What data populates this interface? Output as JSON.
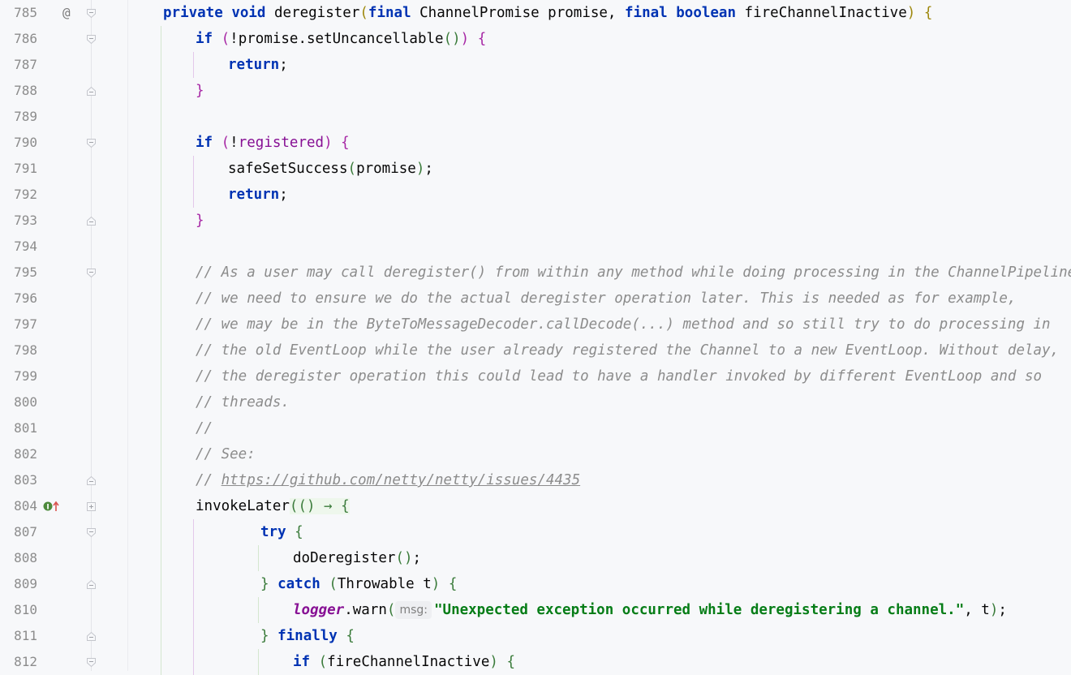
{
  "editor": {
    "lines": [
      {
        "num": "785",
        "gutter": "@",
        "fold": "open",
        "indent": 1,
        "tokens": [
          [
            "kw",
            "private"
          ],
          [
            "",
            " "
          ],
          [
            "kw",
            "void"
          ],
          [
            "",
            " deregister"
          ],
          [
            "bp",
            "("
          ],
          [
            "kw",
            "final"
          ],
          [
            "",
            " ChannelPromise promise, "
          ],
          [
            "kw",
            "final"
          ],
          [
            "",
            " "
          ],
          [
            "kw",
            "boolean"
          ],
          [
            "",
            " fireChannelInactive"
          ],
          [
            "bp",
            ")"
          ],
          [
            "",
            " "
          ],
          [
            "bp",
            "{"
          ]
        ]
      },
      {
        "num": "786",
        "fold": "open",
        "indent": 2,
        "tokens": [
          [
            "kw",
            "if"
          ],
          [
            "",
            " "
          ],
          [
            "bp2",
            "("
          ],
          [
            "",
            "!promise.setUncancellable"
          ],
          [
            "bp3",
            "()"
          ],
          [
            "bp2",
            ")"
          ],
          [
            "",
            " "
          ],
          [
            "bp2",
            "{"
          ]
        ]
      },
      {
        "num": "787",
        "indent": 3,
        "tokens": [
          [
            "kw",
            "return"
          ],
          [
            "",
            ";"
          ]
        ]
      },
      {
        "num": "788",
        "fold": "close",
        "indent": 2,
        "tokens": [
          [
            "bp2",
            "}"
          ]
        ]
      },
      {
        "num": "789",
        "indent": 0,
        "tokens": []
      },
      {
        "num": "790",
        "fold": "open",
        "indent": 2,
        "tokens": [
          [
            "kw",
            "if"
          ],
          [
            "",
            " "
          ],
          [
            "bp2",
            "("
          ],
          [
            "",
            "!"
          ],
          [
            "field",
            "registered"
          ],
          [
            "bp2",
            ")"
          ],
          [
            "",
            " "
          ],
          [
            "bp2",
            "{"
          ]
        ]
      },
      {
        "num": "791",
        "indent": 3,
        "tokens": [
          [
            "",
            "safeSetSuccess"
          ],
          [
            "bp3",
            "("
          ],
          [
            "",
            "promise"
          ],
          [
            "bp3",
            ")"
          ],
          [
            "",
            ";"
          ]
        ]
      },
      {
        "num": "792",
        "indent": 3,
        "tokens": [
          [
            "kw",
            "return"
          ],
          [
            "",
            ";"
          ]
        ]
      },
      {
        "num": "793",
        "fold": "close",
        "indent": 2,
        "tokens": [
          [
            "bp2",
            "}"
          ]
        ]
      },
      {
        "num": "794",
        "indent": 0,
        "tokens": []
      },
      {
        "num": "795",
        "fold": "open",
        "indent": 2,
        "tokens": [
          [
            "cmt",
            "// As a user may call deregister() from within any method while doing processing in the ChannelPipeline,"
          ]
        ]
      },
      {
        "num": "796",
        "indent": 2,
        "tokens": [
          [
            "cmt",
            "// we need to ensure we do the actual deregister operation later. This is needed as for example,"
          ]
        ]
      },
      {
        "num": "797",
        "indent": 2,
        "tokens": [
          [
            "cmt",
            "// we may be in the ByteToMessageDecoder.callDecode(...) method and so still try to do processing in"
          ]
        ]
      },
      {
        "num": "798",
        "indent": 2,
        "tokens": [
          [
            "cmt",
            "// the old EventLoop while the user already registered the Channel to a new EventLoop. Without delay,"
          ]
        ]
      },
      {
        "num": "799",
        "indent": 2,
        "tokens": [
          [
            "cmt",
            "// the deregister operation this could lead to have a handler invoked by different EventLoop and so"
          ]
        ]
      },
      {
        "num": "800",
        "indent": 2,
        "tokens": [
          [
            "cmt",
            "// threads."
          ]
        ]
      },
      {
        "num": "801",
        "indent": 2,
        "tokens": [
          [
            "cmt",
            "//"
          ]
        ]
      },
      {
        "num": "802",
        "indent": 2,
        "tokens": [
          [
            "cmt",
            "// See:"
          ]
        ]
      },
      {
        "num": "803",
        "fold": "close",
        "indent": 2,
        "tokens": [
          [
            "cmt",
            "// "
          ],
          [
            "cmt link",
            "https://github.com/netty/netty/issues/4435"
          ]
        ]
      },
      {
        "num": "804",
        "vcs": true,
        "fold": "plus",
        "indent": 2,
        "tokens": [
          [
            "",
            "invokeLater"
          ],
          [
            "bp3 lambda-hl",
            "(() → {"
          ]
        ]
      },
      {
        "num": "807",
        "fold": "open",
        "indent": 4,
        "tokens": [
          [
            "kw",
            "try"
          ],
          [
            "",
            " "
          ],
          [
            "bp3",
            "{"
          ]
        ]
      },
      {
        "num": "808",
        "indent": 5,
        "tokens": [
          [
            "",
            "doDeregister"
          ],
          [
            "bp3",
            "()"
          ],
          [
            "",
            ";"
          ]
        ]
      },
      {
        "num": "809",
        "fold": "close",
        "indent": 4,
        "tokens": [
          [
            "bp3",
            "}"
          ],
          [
            "",
            " "
          ],
          [
            "kw",
            "catch"
          ],
          [
            "",
            " "
          ],
          [
            "bp3",
            "("
          ],
          [
            "",
            "Throwable t"
          ],
          [
            "bp3",
            ")"
          ],
          [
            "",
            " "
          ],
          [
            "bp3",
            "{"
          ]
        ]
      },
      {
        "num": "810",
        "indent": 5,
        "tokens": [
          [
            "static",
            "logger"
          ],
          [
            "",
            ".warn"
          ],
          [
            "bp3",
            "("
          ],
          [
            "hint",
            "msg:"
          ],
          [
            "str",
            "\"Unexpected exception occurred while deregistering a channel.\""
          ],
          [
            "",
            ", t"
          ],
          [
            "bp3",
            ")"
          ],
          [
            "",
            ";"
          ]
        ]
      },
      {
        "num": "811",
        "fold": "close",
        "indent": 4,
        "tokens": [
          [
            "bp3",
            "}"
          ],
          [
            "",
            " "
          ],
          [
            "kw",
            "finally"
          ],
          [
            "",
            " "
          ],
          [
            "bp3",
            "{"
          ]
        ]
      },
      {
        "num": "812",
        "fold": "open",
        "indent": 5,
        "tokens": [
          [
            "kw",
            "if"
          ],
          [
            "",
            " "
          ],
          [
            "bp3",
            "("
          ],
          [
            "",
            "fireChannelInactive"
          ],
          [
            "bp3",
            ")"
          ],
          [
            "",
            " "
          ],
          [
            "bp3",
            "{"
          ]
        ]
      }
    ]
  }
}
